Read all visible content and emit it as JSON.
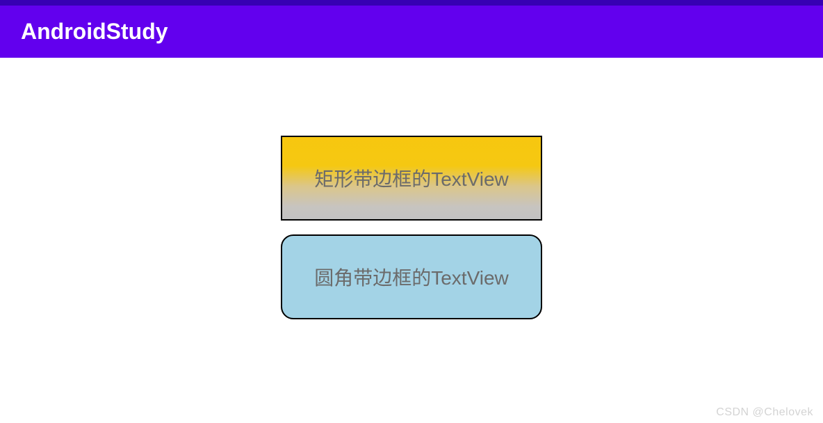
{
  "appBar": {
    "title": "AndroidStudy"
  },
  "textViews": {
    "rectangleBordered": {
      "label": "矩形带边框的TextView"
    },
    "roundedBordered": {
      "label": "圆角带边框的TextView"
    }
  },
  "watermark": "CSDN @Chelovek"
}
